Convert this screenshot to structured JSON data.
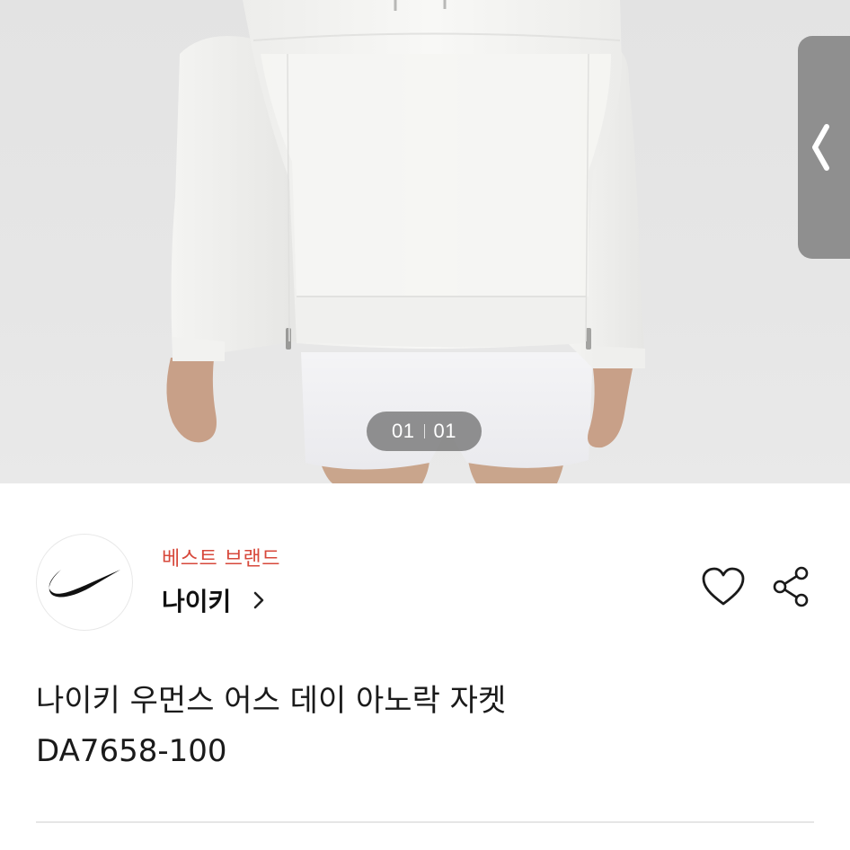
{
  "gallery": {
    "current": "01",
    "total": "01"
  },
  "brand": {
    "badge": "베스트 브랜드",
    "name": "나이키",
    "logo": "nike-swoosh-logo",
    "badge_color": "#d7483b"
  },
  "product": {
    "title_line1": "나이키 우먼스 어스 데이 아노락 자켓",
    "title_line2": "DA7658-100"
  },
  "actions": {
    "wishlist_icon": "heart-outline-icon",
    "share_icon": "share-icon",
    "prev_icon": "chevron-left-icon"
  }
}
